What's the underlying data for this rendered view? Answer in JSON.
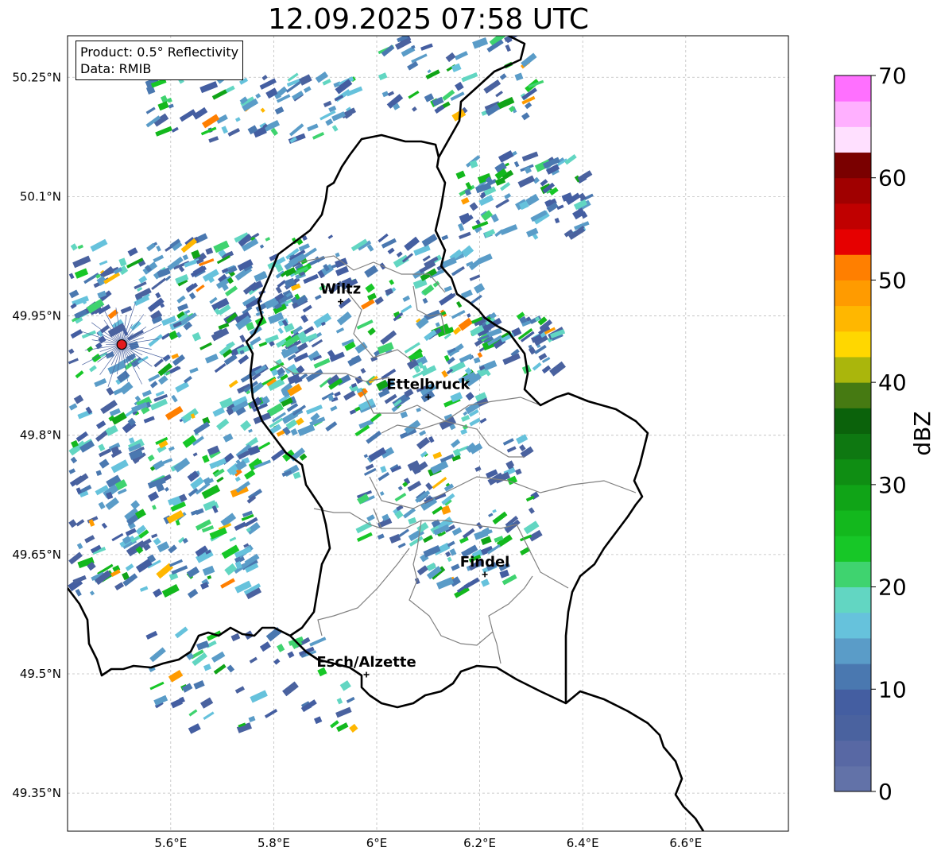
{
  "title": "12.09.2025 07:58 UTC",
  "info_box": {
    "product": "Product: 0.5° Reflectivity",
    "data": "Data: RMIB"
  },
  "map": {
    "lon_range": [
      5.4,
      6.8
    ],
    "lat_range": [
      49.3,
      50.3
    ],
    "x_ticks": [
      {
        "value": 5.6,
        "label": "5.6°E"
      },
      {
        "value": 5.8,
        "label": "5.8°E"
      },
      {
        "value": 6.0,
        "label": "6°E"
      },
      {
        "value": 6.2,
        "label": "6.2°E"
      },
      {
        "value": 6.4,
        "label": "6.4°E"
      },
      {
        "value": 6.6,
        "label": "6.6°E"
      }
    ],
    "y_ticks": [
      {
        "value": 50.25,
        "label": "50.25°N"
      },
      {
        "value": 50.1,
        "label": "50.1°N"
      },
      {
        "value": 49.95,
        "label": "49.95°N"
      },
      {
        "value": 49.8,
        "label": "49.8°N"
      },
      {
        "value": 49.65,
        "label": "49.65°N"
      },
      {
        "value": 49.5,
        "label": "49.5°N"
      },
      {
        "value": 49.35,
        "label": "49.35°N"
      }
    ],
    "grid": true,
    "cities": [
      {
        "name": "Wiltz",
        "lon": 5.93,
        "lat": 49.968
      },
      {
        "name": "Ettelbruck",
        "lon": 6.1,
        "lat": 49.848
      },
      {
        "name": "Findel",
        "lon": 6.21,
        "lat": 49.625
      },
      {
        "name": "Esch/Alzette",
        "lon": 5.98,
        "lat": 49.499
      }
    ],
    "radar_site": {
      "lon": 5.505,
      "lat": 49.914,
      "color": "#e41a1c"
    },
    "echo_regions": [
      {
        "lon": [
          5.4,
          5.85
        ],
        "lat": [
          49.75,
          50.05
        ],
        "n": 420
      },
      {
        "lon": [
          5.8,
          6.2
        ],
        "lat": [
          49.8,
          50.05
        ],
        "n": 260
      },
      {
        "lon": [
          6.15,
          6.4
        ],
        "lat": [
          50.05,
          50.15
        ],
        "n": 90
      },
      {
        "lon": [
          5.55,
          5.95
        ],
        "lat": [
          50.17,
          50.25
        ],
        "n": 80
      },
      {
        "lon": [
          6.0,
          6.3
        ],
        "lat": [
          50.2,
          50.3
        ],
        "n": 60
      },
      {
        "lon": [
          5.95,
          6.3
        ],
        "lat": [
          49.65,
          49.8
        ],
        "n": 110
      },
      {
        "lon": [
          6.05,
          6.25
        ],
        "lat": [
          49.6,
          49.68
        ],
        "n": 40
      },
      {
        "lon": [
          5.4,
          5.75
        ],
        "lat": [
          49.6,
          49.75
        ],
        "n": 150
      },
      {
        "lon": [
          5.55,
          5.95
        ],
        "lat": [
          49.43,
          49.55
        ],
        "n": 60
      },
      {
        "lon": [
          6.18,
          6.34
        ],
        "lat": [
          49.88,
          49.95
        ],
        "n": 60
      }
    ]
  },
  "colorbar": {
    "label": "dBZ",
    "min": 0,
    "max": 70,
    "step": 2.5,
    "ticks": [
      0,
      10,
      20,
      30,
      40,
      50,
      60,
      70
    ],
    "colors": [
      "#6272a8",
      "#5868a4",
      "#4a629f",
      "#445ea1",
      "#4a78b0",
      "#5a9cc8",
      "#66c2dc",
      "#62d6c2",
      "#3fd36f",
      "#17c727",
      "#13b81d",
      "#10a417",
      "#0f8e13",
      "#0e7811",
      "#0b620b",
      "#467a12",
      "#aab60c",
      "#ffd700",
      "#ffb700",
      "#ff9b00",
      "#ff7f00",
      "#e60000",
      "#c00000",
      "#a00000",
      "#7a0000",
      "#ffe0ff",
      "#ffb0ff",
      "#ff70ff",
      "#ea38ea"
    ]
  }
}
